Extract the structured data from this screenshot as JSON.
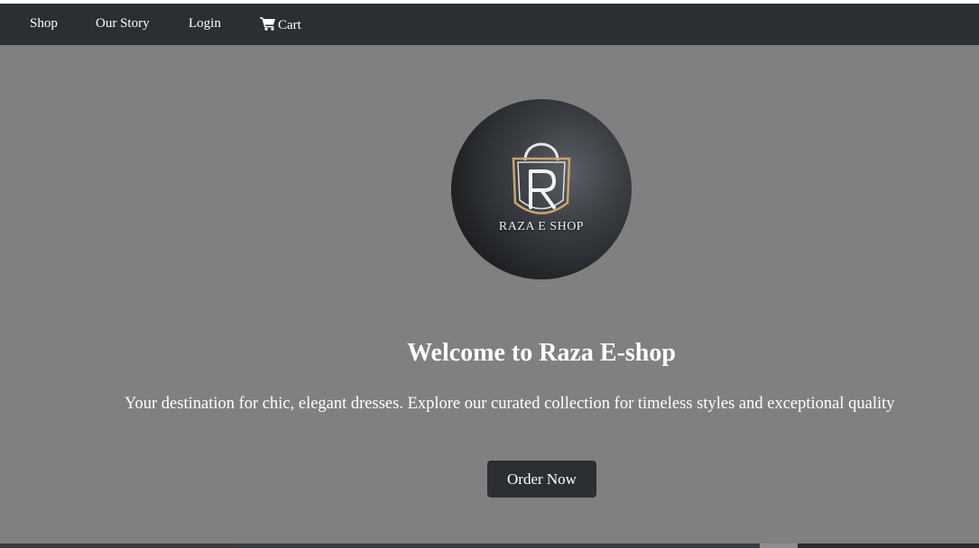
{
  "nav": {
    "shop": "Shop",
    "our_story": "Our Story",
    "login": "Login",
    "cart": "Cart"
  },
  "logo": {
    "text": "RAZA E SHOP"
  },
  "hero": {
    "title": "Welcome to Raza E-shop",
    "subtitle": "Your destination for chic, elegant dresses. Explore our curated collection for timeless styles and exceptional quality",
    "cta": "Order Now"
  },
  "colors": {
    "navbar": "#2b2e33",
    "hero_bg": "#808080",
    "button": "#2b2e33",
    "text": "#ffffff",
    "logo_gold": "#c9a46a"
  },
  "icons": {
    "cart": "cart-icon"
  }
}
